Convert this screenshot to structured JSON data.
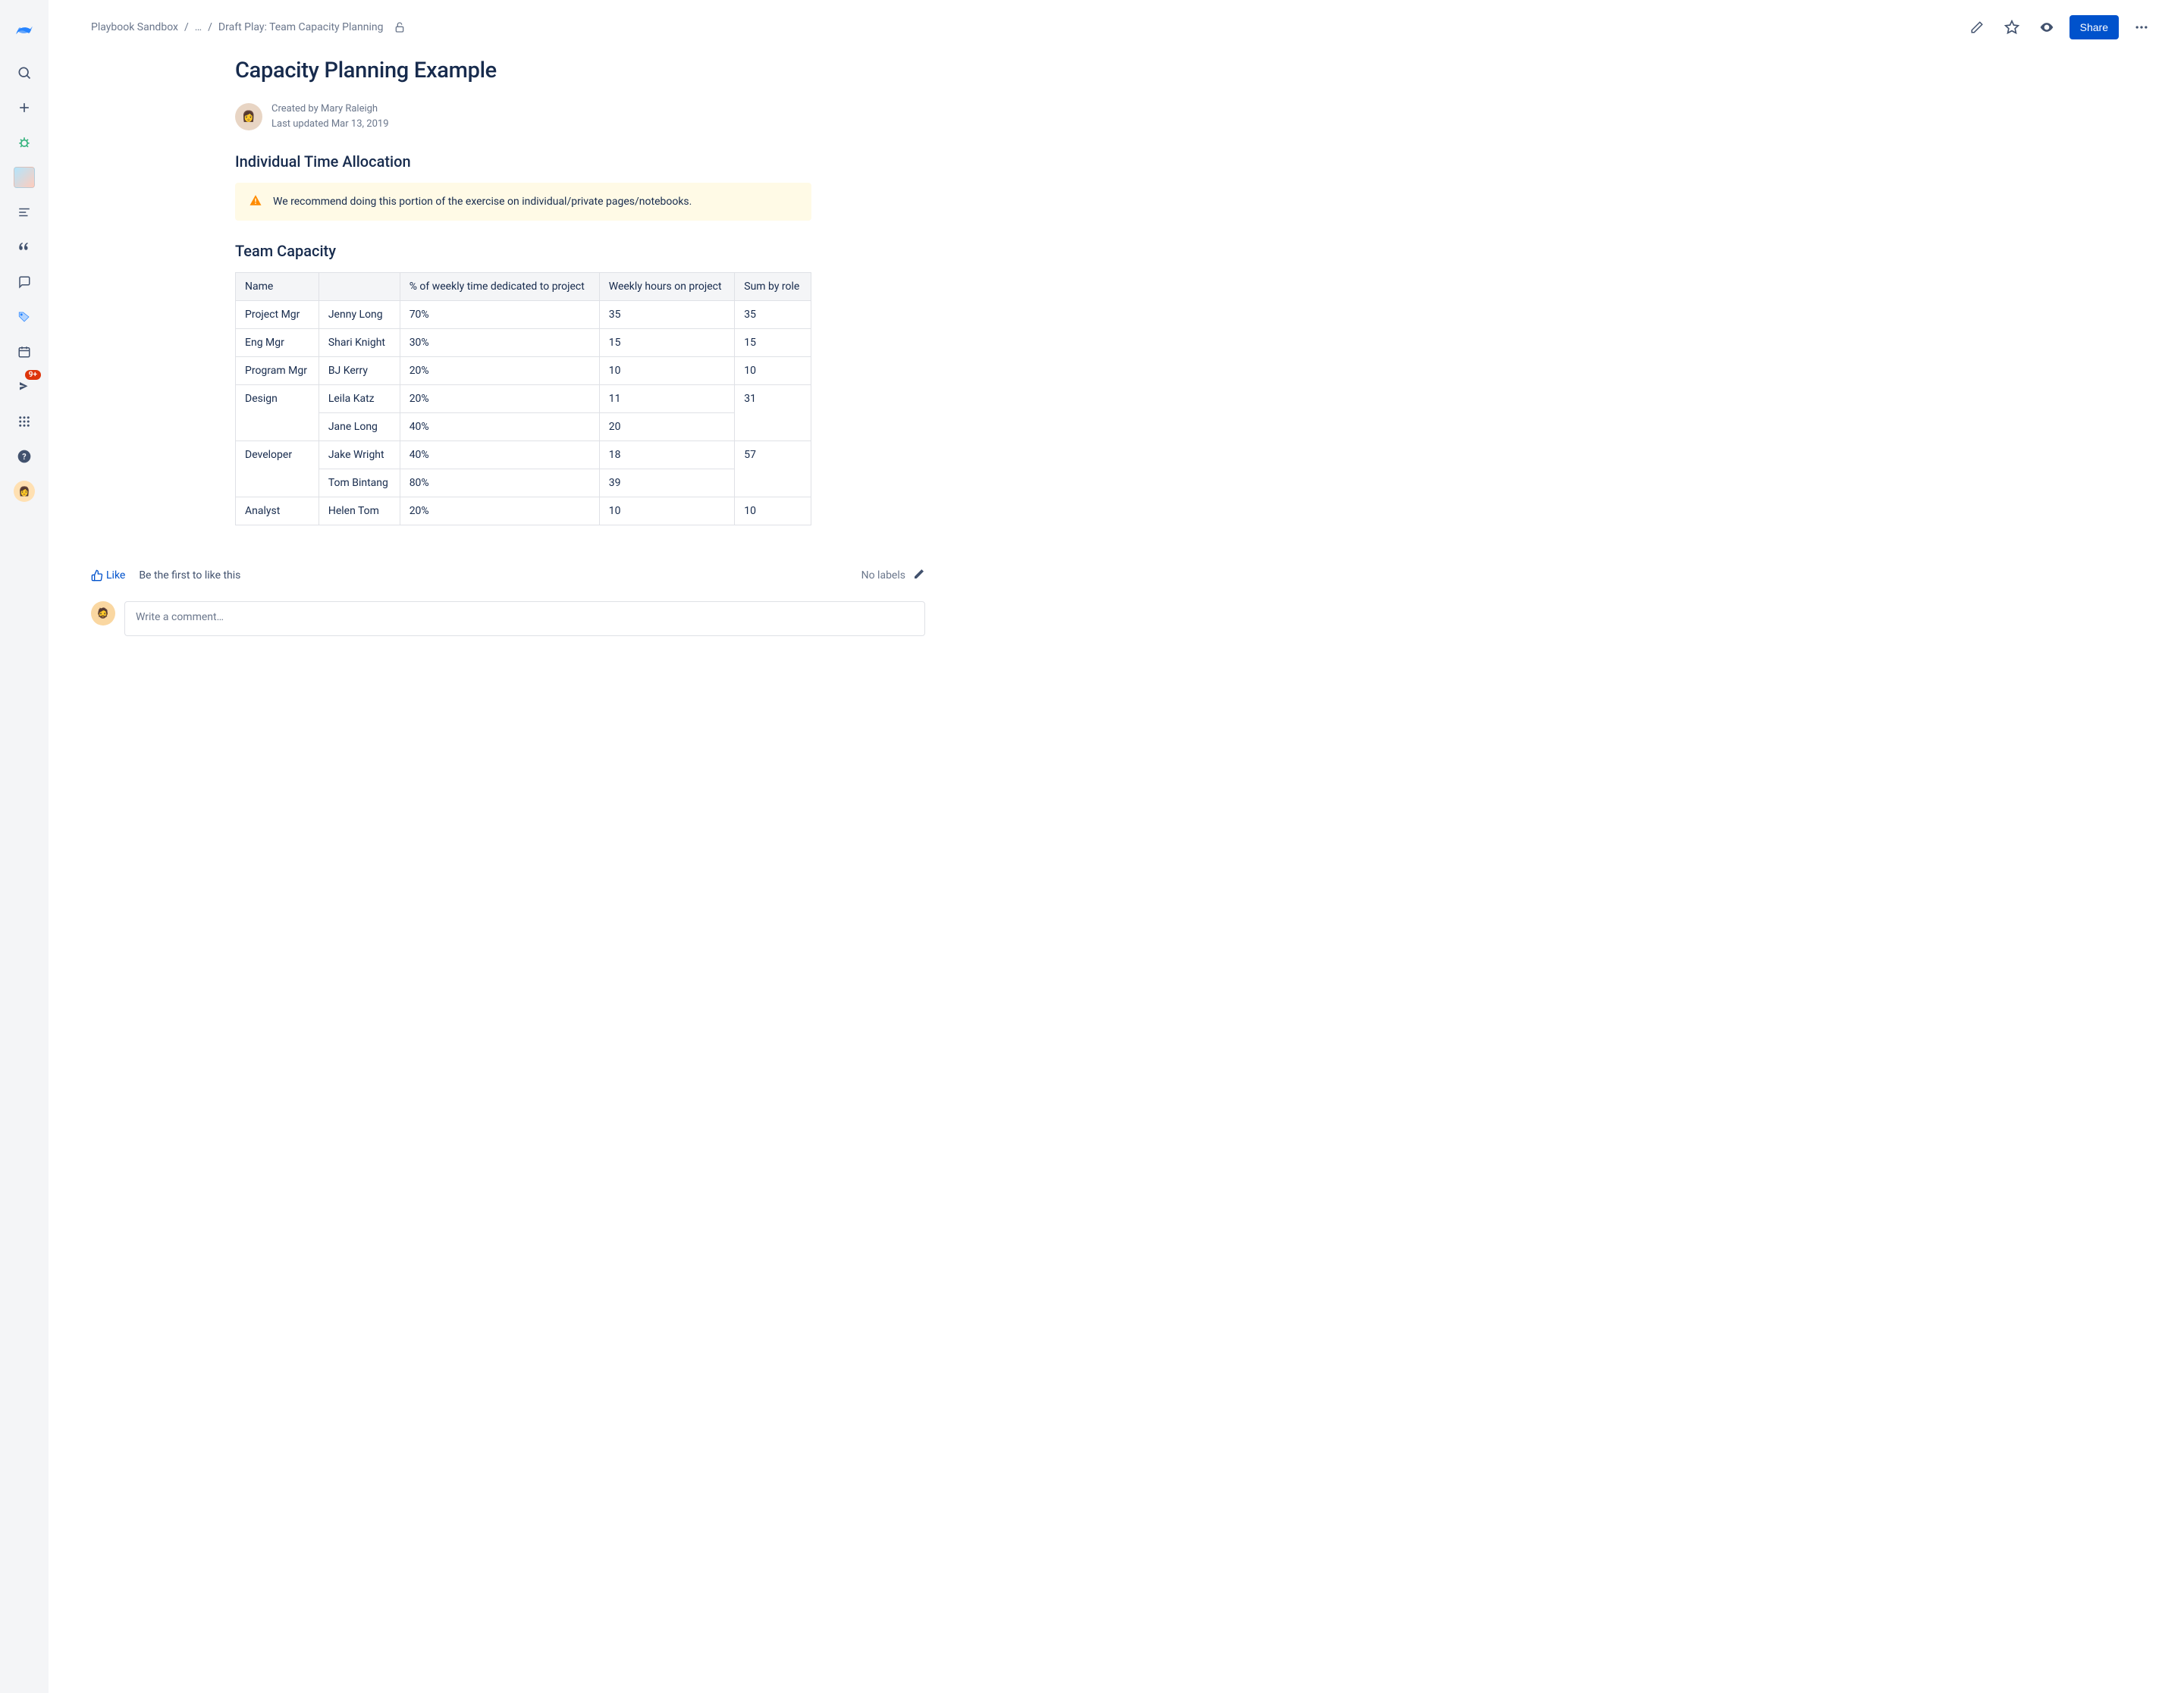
{
  "breadcrumbs": {
    "space": "Playbook Sandbox",
    "ellipsis": "…",
    "page": "Draft Play: Team Capacity Planning"
  },
  "actions": {
    "share": "Share"
  },
  "page": {
    "title": "Capacity Planning Example",
    "created_by_line": "Created by Mary Raleigh",
    "updated_line": "Last updated Mar 13, 2019"
  },
  "sections": {
    "individual": "Individual Time Allocation",
    "note": "We recommend doing this portion of the exercise on individual/private pages/notebooks.",
    "team": "Team Capacity"
  },
  "table": {
    "headers": {
      "name": "Name",
      "blank": "",
      "pct": "% of weekly time dedicated to project",
      "hours": "Weekly hours on project",
      "sum": "Sum by role"
    },
    "rows": [
      {
        "role": "Project Mgr",
        "person": "Jenny Long",
        "pct": "70%",
        "hours": "35",
        "sum": "35"
      },
      {
        "role": "Eng Mgr",
        "person": "Shari Knight",
        "pct": "30%",
        "hours": "15",
        "sum": "15"
      },
      {
        "role": "Program Mgr",
        "person": "BJ Kerry",
        "pct": "20%",
        "hours": "10",
        "sum": "10"
      },
      {
        "role": "Design",
        "person": "Leila Katz",
        "pct": "20%",
        "hours": "11",
        "sum": "31"
      },
      {
        "role": "",
        "person": "Jane Long",
        "pct": "40%",
        "hours": "20",
        "sum": ""
      },
      {
        "role": "Developer",
        "person": "Jake Wright",
        "pct": "40%",
        "hours": "18",
        "sum": "57"
      },
      {
        "role": "",
        "person": "Tom Bintang",
        "pct": "80%",
        "hours": "39",
        "sum": ""
      },
      {
        "role": "Analyst",
        "person": "Helen Tom",
        "pct": "20%",
        "hours": "10",
        "sum": "10"
      }
    ]
  },
  "footer": {
    "like": "Like",
    "like_status": "Be the first to like this",
    "no_labels": "No labels",
    "comment_placeholder": "Write a comment…"
  },
  "sidebar": {
    "notification_badge": "9+"
  }
}
